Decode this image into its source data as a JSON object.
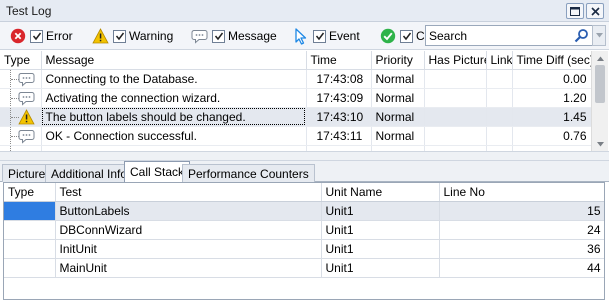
{
  "window": {
    "title": "Test Log"
  },
  "filters": [
    {
      "label": "Error",
      "icon": "error-icon",
      "checked": true
    },
    {
      "label": "Warning",
      "icon": "warning-icon",
      "checked": true
    },
    {
      "label": "Message",
      "icon": "message-icon",
      "checked": true
    },
    {
      "label": "Event",
      "icon": "event-icon",
      "checked": true
    },
    {
      "label": "C",
      "icon": "checkpoint-icon",
      "checked": true
    }
  ],
  "search": {
    "value": "Search"
  },
  "log": {
    "columns": [
      "Type",
      "Message",
      "Time",
      "Priority",
      "Has Picture",
      "Link",
      "Time Diff (sec)"
    ],
    "rows": [
      {
        "type": "message-icon",
        "message": "Connecting to the Database.",
        "time": "17:43:08",
        "priority": "Normal",
        "has_picture": "",
        "link": "",
        "time_diff": "0.00"
      },
      {
        "type": "message-icon",
        "message": "Activating the connection wizard.",
        "time": "17:43:09",
        "priority": "Normal",
        "has_picture": "",
        "link": "",
        "time_diff": "1.20"
      },
      {
        "type": "warning-icon",
        "message": "The button labels should be changed.",
        "time": "17:43:10",
        "priority": "Normal",
        "has_picture": "",
        "link": "",
        "time_diff": "1.45"
      },
      {
        "type": "message-icon",
        "message": "OK - Connection successful.",
        "time": "17:43:11",
        "priority": "Normal",
        "has_picture": "",
        "link": "",
        "time_diff": "0.76"
      }
    ]
  },
  "tabs": [
    "Picture",
    "Additional Info",
    "Call Stack",
    "Performance Counters"
  ],
  "active_tab": "Call Stack",
  "callstack": {
    "columns": [
      "Type",
      "Test",
      "Unit Name",
      "Line No"
    ],
    "rows": [
      {
        "type": "",
        "test": "ButtonLabels",
        "unit": "Unit1",
        "line": "15"
      },
      {
        "type": "",
        "test": "DBConnWizard",
        "unit": "Unit1",
        "line": "24"
      },
      {
        "type": "",
        "test": "InitUnit",
        "unit": "Unit1",
        "line": "36"
      },
      {
        "type": "",
        "test": "MainUnit",
        "unit": "Unit1",
        "line": "44"
      }
    ]
  },
  "colors": {
    "selection": "#2f7de1",
    "error": "#d9262c",
    "warning": "#f3c300",
    "checkpoint": "#2fb34a",
    "event": "#1e88e5"
  }
}
